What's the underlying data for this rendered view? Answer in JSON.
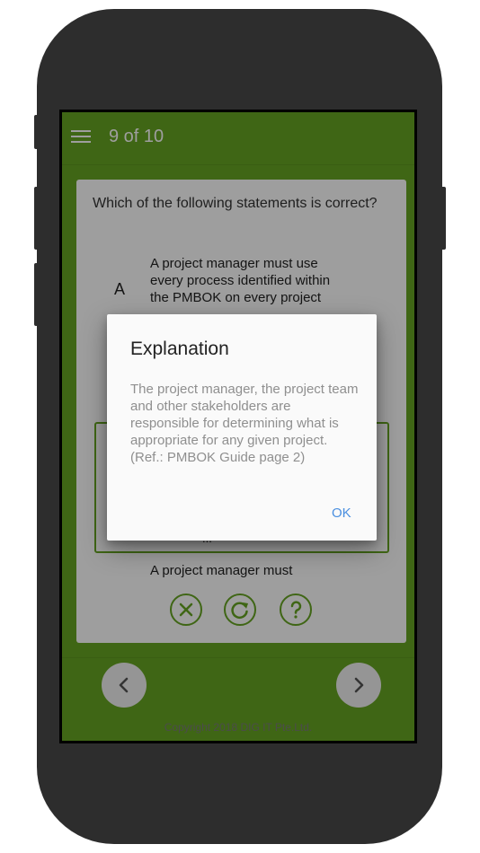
{
  "header": {
    "title": "9 of 10",
    "menu_icon": "hamburger-menu-icon"
  },
  "question": {
    "text": "Which of the following statements is correct?",
    "option_a_letter": "A",
    "option_a_text": "A project manager must use every process identified within the PMBOK on every project",
    "option_peek_text": "...",
    "option_last_text": "A project manager must"
  },
  "actions": {
    "icons": [
      "close-circle-icon",
      "reset-icon",
      "help-icon"
    ]
  },
  "footer": {
    "copyright": "Copyright 2018 DIG IT Pte.Ltd.",
    "prev_icon": "chevron-left-icon",
    "next_icon": "chevron-right-icon"
  },
  "dialog": {
    "title": "Explanation",
    "body": "The project manager, the project team and other stakeholders are responsible for determining what is appropriate for any given project. (Ref.: PMBOK Guide page 2)",
    "ok_label": "OK"
  },
  "colors": {
    "primary": "#67a523",
    "frame": "#2d2d2d",
    "link": "#4a8fe0"
  }
}
